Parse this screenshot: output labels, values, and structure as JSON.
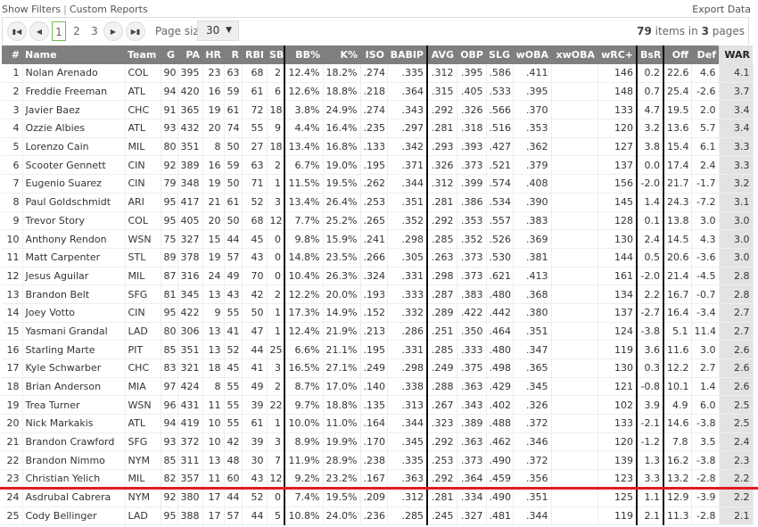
{
  "top": {
    "show_filters": "Show Filters",
    "separator": "|",
    "custom_reports": "Custom Reports",
    "export": "Export Data"
  },
  "pager": {
    "first_icon": "first-page-icon",
    "prev_icon": "prev-page-icon",
    "next_icon": "next-page-icon",
    "last_icon": "last-page-icon",
    "pages": [
      "1",
      "2",
      "3"
    ],
    "current_page": "1",
    "page_size_label": "Page size:",
    "page_size": "30",
    "total_items": "79",
    "items_text": "items in",
    "total_pages": "3",
    "pages_text": "pages"
  },
  "colors": {
    "header_bg": "#7f7f7f",
    "war_bg": "#e3e3e3",
    "cutoff_line": "#e31b23",
    "current_page_border": "#6fbf4f"
  },
  "columns": [
    "#",
    "Name",
    "Team",
    "G",
    "PA",
    "HR",
    "R",
    "RBI",
    "SB",
    "BB%",
    "K%",
    "ISO",
    "BABIP",
    "AVG",
    "OBP",
    "SLG",
    "wOBA",
    "xwOBA",
    "wRC+",
    "BsR",
    "Off",
    "Def",
    "WAR"
  ],
  "rows": [
    [
      "1",
      "Nolan Arenado",
      "COL",
      "90",
      "395",
      "23",
      "63",
      "68",
      "2",
      "12.4%",
      "18.2%",
      ".274",
      ".335",
      ".312",
      ".395",
      ".586",
      ".411",
      "",
      "146",
      "0.2",
      "22.6",
      "4.6",
      "4.1"
    ],
    [
      "2",
      "Freddie Freeman",
      "ATL",
      "94",
      "420",
      "16",
      "59",
      "61",
      "6",
      "12.6%",
      "18.8%",
      ".218",
      ".364",
      ".315",
      ".405",
      ".533",
      ".395",
      "",
      "148",
      "0.7",
      "25.4",
      "-2.6",
      "3.7"
    ],
    [
      "3",
      "Javier Baez",
      "CHC",
      "91",
      "365",
      "19",
      "61",
      "72",
      "18",
      "3.8%",
      "24.9%",
      ".274",
      ".343",
      ".292",
      ".326",
      ".566",
      ".370",
      "",
      "133",
      "4.7",
      "19.5",
      "2.0",
      "3.4"
    ],
    [
      "4",
      "Ozzie Albies",
      "ATL",
      "93",
      "432",
      "20",
      "74",
      "55",
      "9",
      "4.4%",
      "16.4%",
      ".235",
      ".297",
      ".281",
      ".318",
      ".516",
      ".353",
      "",
      "120",
      "3.2",
      "13.6",
      "5.7",
      "3.4"
    ],
    [
      "5",
      "Lorenzo Cain",
      "MIL",
      "80",
      "351",
      "8",
      "50",
      "27",
      "18",
      "13.4%",
      "16.8%",
      ".133",
      ".342",
      ".293",
      ".393",
      ".427",
      ".362",
      "",
      "127",
      "3.8",
      "15.4",
      "6.1",
      "3.3"
    ],
    [
      "6",
      "Scooter Gennett",
      "CIN",
      "92",
      "389",
      "16",
      "59",
      "63",
      "2",
      "6.7%",
      "19.0%",
      ".195",
      ".371",
      ".326",
      ".373",
      ".521",
      ".379",
      "",
      "137",
      "0.0",
      "17.4",
      "2.4",
      "3.3"
    ],
    [
      "7",
      "Eugenio Suarez",
      "CIN",
      "79",
      "348",
      "19",
      "50",
      "71",
      "1",
      "11.5%",
      "19.5%",
      ".262",
      ".344",
      ".312",
      ".399",
      ".574",
      ".408",
      "",
      "156",
      "-2.0",
      "21.7",
      "-1.7",
      "3.2"
    ],
    [
      "8",
      "Paul Goldschmidt",
      "ARI",
      "95",
      "417",
      "21",
      "61",
      "52",
      "3",
      "13.4%",
      "26.4%",
      ".253",
      ".351",
      ".281",
      ".386",
      ".534",
      ".390",
      "",
      "145",
      "1.4",
      "24.3",
      "-7.2",
      "3.1"
    ],
    [
      "9",
      "Trevor Story",
      "COL",
      "95",
      "405",
      "20",
      "50",
      "68",
      "12",
      "7.7%",
      "25.2%",
      ".265",
      ".352",
      ".292",
      ".353",
      ".557",
      ".383",
      "",
      "128",
      "0.1",
      "13.8",
      "3.0",
      "3.0"
    ],
    [
      "10",
      "Anthony Rendon",
      "WSN",
      "75",
      "327",
      "15",
      "44",
      "45",
      "0",
      "9.8%",
      "15.9%",
      ".241",
      ".298",
      ".285",
      ".352",
      ".526",
      ".369",
      "",
      "130",
      "2.4",
      "14.5",
      "4.3",
      "3.0"
    ],
    [
      "11",
      "Matt Carpenter",
      "STL",
      "89",
      "378",
      "19",
      "57",
      "43",
      "0",
      "14.8%",
      "23.5%",
      ".266",
      ".305",
      ".263",
      ".373",
      ".530",
      ".381",
      "",
      "144",
      "0.5",
      "20.6",
      "-3.6",
      "3.0"
    ],
    [
      "12",
      "Jesus Aguilar",
      "MIL",
      "87",
      "316",
      "24",
      "49",
      "70",
      "0",
      "10.4%",
      "26.3%",
      ".324",
      ".331",
      ".298",
      ".373",
      ".621",
      ".413",
      "",
      "161",
      "-2.0",
      "21.4",
      "-4.5",
      "2.8"
    ],
    [
      "13",
      "Brandon Belt",
      "SFG",
      "81",
      "345",
      "13",
      "43",
      "42",
      "2",
      "12.2%",
      "20.0%",
      ".193",
      ".333",
      ".287",
      ".383",
      ".480",
      ".368",
      "",
      "134",
      "2.2",
      "16.7",
      "-0.7",
      "2.8"
    ],
    [
      "14",
      "Joey Votto",
      "CIN",
      "95",
      "422",
      "9",
      "55",
      "50",
      "1",
      "17.3%",
      "14.9%",
      ".152",
      ".332",
      ".289",
      ".422",
      ".442",
      ".380",
      "",
      "137",
      "-2.7",
      "16.4",
      "-3.4",
      "2.7"
    ],
    [
      "15",
      "Yasmani Grandal",
      "LAD",
      "80",
      "306",
      "13",
      "41",
      "47",
      "1",
      "12.4%",
      "21.9%",
      ".213",
      ".286",
      ".251",
      ".350",
      ".464",
      ".351",
      "",
      "124",
      "-3.8",
      "5.1",
      "11.4",
      "2.7"
    ],
    [
      "16",
      "Starling Marte",
      "PIT",
      "85",
      "351",
      "13",
      "52",
      "44",
      "25",
      "6.6%",
      "21.1%",
      ".195",
      ".331",
      ".285",
      ".333",
      ".480",
      ".347",
      "",
      "119",
      "3.6",
      "11.6",
      "3.0",
      "2.6"
    ],
    [
      "17",
      "Kyle Schwarber",
      "CHC",
      "83",
      "321",
      "18",
      "45",
      "41",
      "3",
      "16.5%",
      "27.1%",
      ".249",
      ".298",
      ".249",
      ".375",
      ".498",
      ".365",
      "",
      "130",
      "0.3",
      "12.2",
      "2.7",
      "2.6"
    ],
    [
      "18",
      "Brian Anderson",
      "MIA",
      "97",
      "424",
      "8",
      "55",
      "49",
      "2",
      "8.7%",
      "17.0%",
      ".140",
      ".338",
      ".288",
      ".363",
      ".429",
      ".345",
      "",
      "121",
      "-0.8",
      "10.1",
      "1.4",
      "2.6"
    ],
    [
      "19",
      "Trea Turner",
      "WSN",
      "96",
      "431",
      "11",
      "55",
      "39",
      "22",
      "9.7%",
      "18.8%",
      ".135",
      ".313",
      ".267",
      ".343",
      ".402",
      ".326",
      "",
      "102",
      "3.9",
      "4.9",
      "6.0",
      "2.5"
    ],
    [
      "20",
      "Nick Markakis",
      "ATL",
      "94",
      "419",
      "10",
      "55",
      "61",
      "1",
      "10.0%",
      "11.0%",
      ".164",
      ".344",
      ".323",
      ".389",
      ".488",
      ".372",
      "",
      "133",
      "-2.1",
      "14.6",
      "-3.8",
      "2.5"
    ],
    [
      "21",
      "Brandon Crawford",
      "SFG",
      "93",
      "372",
      "10",
      "42",
      "39",
      "3",
      "8.9%",
      "19.9%",
      ".170",
      ".345",
      ".292",
      ".363",
      ".462",
      ".346",
      "",
      "120",
      "-1.2",
      "7.8",
      "3.5",
      "2.4"
    ],
    [
      "22",
      "Brandon Nimmo",
      "NYM",
      "85",
      "311",
      "13",
      "48",
      "30",
      "7",
      "11.9%",
      "28.9%",
      ".238",
      ".335",
      ".253",
      ".373",
      ".490",
      ".372",
      "",
      "139",
      "1.3",
      "16.2",
      "-3.8",
      "2.3"
    ],
    [
      "23",
      "Christian Yelich",
      "MIL",
      "82",
      "357",
      "11",
      "60",
      "43",
      "12",
      "9.2%",
      "23.2%",
      ".167",
      ".363",
      ".292",
      ".364",
      ".459",
      ".356",
      "",
      "123",
      "3.3",
      "13.2",
      "-2.8",
      "2.2"
    ],
    [
      "24",
      "Asdrubal Cabrera",
      "NYM",
      "92",
      "380",
      "17",
      "44",
      "52",
      "0",
      "7.4%",
      "19.5%",
      ".209",
      ".312",
      ".281",
      ".334",
      ".490",
      ".351",
      "",
      "125",
      "1.1",
      "12.9",
      "-3.9",
      "2.2"
    ],
    [
      "25",
      "Cody Bellinger",
      "LAD",
      "95",
      "388",
      "17",
      "57",
      "44",
      "5",
      "10.8%",
      "24.0%",
      ".236",
      ".285",
      ".245",
      ".327",
      ".481",
      ".344",
      "",
      "119",
      "2.1",
      "11.3",
      "-2.8",
      "2.1"
    ]
  ]
}
